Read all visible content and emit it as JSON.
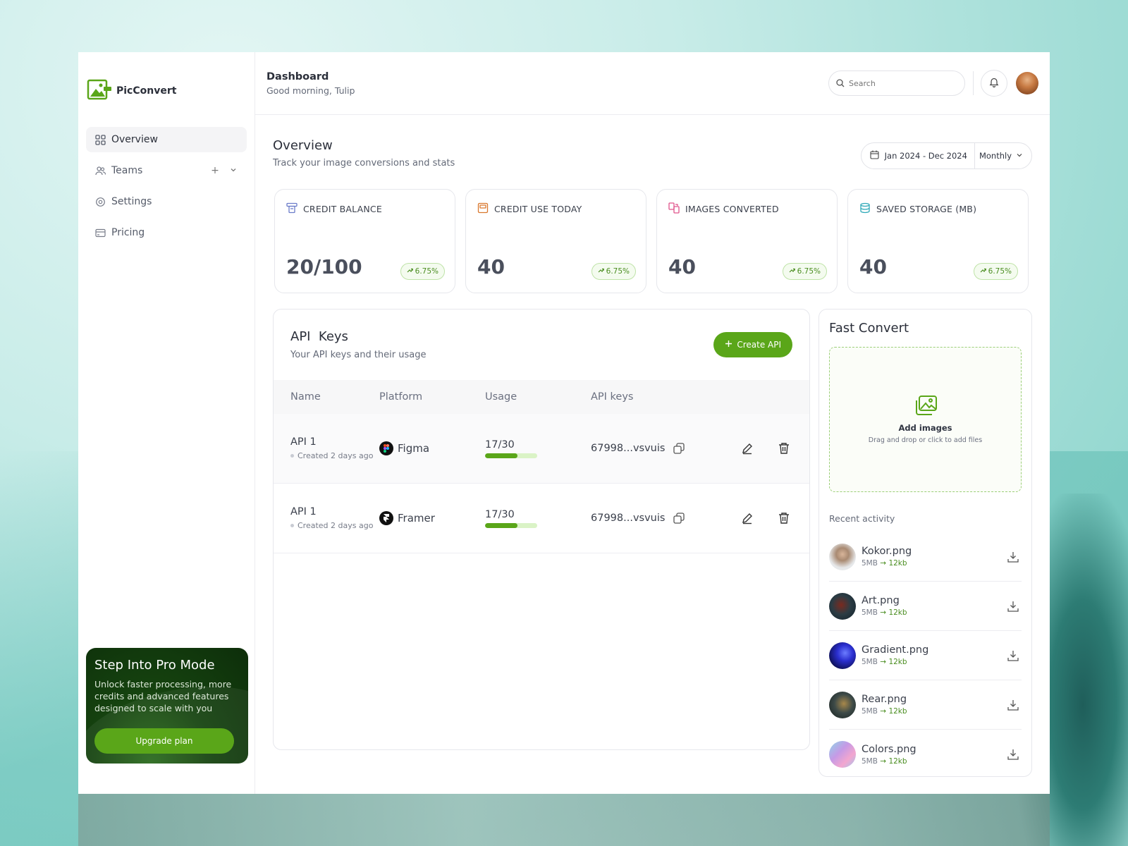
{
  "brand": {
    "name": "PicConvert",
    "accent": "#5aa619"
  },
  "sidebar": {
    "items": [
      {
        "label": "Overview",
        "icon": "grid-icon"
      },
      {
        "label": "Teams",
        "icon": "users-icon"
      },
      {
        "label": "Settings",
        "icon": "settings-icon"
      },
      {
        "label": "Pricing",
        "icon": "card-icon"
      }
    ],
    "promo": {
      "title": "Step Into Pro Mode",
      "text": "Unlock faster processing, more credits and advanced features designed to scale with you",
      "button": "Upgrade plan"
    }
  },
  "header": {
    "title": "Dashboard",
    "greeting": "Good morning, Tulip",
    "search_placeholder": "Search"
  },
  "overview": {
    "title": "Overview",
    "subtitle": "Track your image conversions and stats",
    "date_range": "Jan 2024 - Dec 2024",
    "period": "Monthly"
  },
  "stats": [
    {
      "label": "CREDIT BALANCE",
      "value": "20/100",
      "change": "6.75%",
      "icon": "credit-icon",
      "color": "#6b7cc9"
    },
    {
      "label": "CREDIT USE TODAY",
      "value": "40",
      "change": "6.75%",
      "icon": "wallet-icon",
      "color": "#d9782e"
    },
    {
      "label": "IMAGES CONVERTED",
      "value": "40",
      "change": "6.75%",
      "icon": "convert-icon",
      "color": "#e0548c"
    },
    {
      "label": "SAVED STORAGE (MB)",
      "value": "40",
      "change": "6.75%",
      "icon": "database-icon",
      "color": "#2fa9b8"
    }
  ],
  "api": {
    "title": "API  Keys",
    "subtitle": "Your API keys and their usage",
    "create_label": "Create API",
    "columns": [
      "Name",
      "Platform",
      "Usage",
      "API keys"
    ],
    "rows": [
      {
        "name": "API 1",
        "created": "Created 2 days ago",
        "platform": "Figma",
        "usage": "17/30",
        "usage_fraction": 0.62,
        "key": "67998...vsvuis"
      },
      {
        "name": "API 1",
        "created": "Created 2 days ago",
        "platform": "Framer",
        "usage": "17/30",
        "usage_fraction": 0.62,
        "key": "67998...vsvuis"
      }
    ]
  },
  "fast_convert": {
    "title": "Fast Convert",
    "drop_title": "Add images",
    "drop_sub": "Drag and drop or click to add files",
    "recent_label": "Recent activity",
    "items": [
      {
        "name": "Kokor.png",
        "from": "5MB",
        "to": "12kb"
      },
      {
        "name": "Art.png",
        "from": "5MB",
        "to": "12kb"
      },
      {
        "name": "Gradient.png",
        "from": "5MB",
        "to": "12kb"
      },
      {
        "name": "Rear.png",
        "from": "5MB",
        "to": "12kb"
      },
      {
        "name": "Colors.png",
        "from": "5MB",
        "to": "12kb"
      }
    ]
  }
}
